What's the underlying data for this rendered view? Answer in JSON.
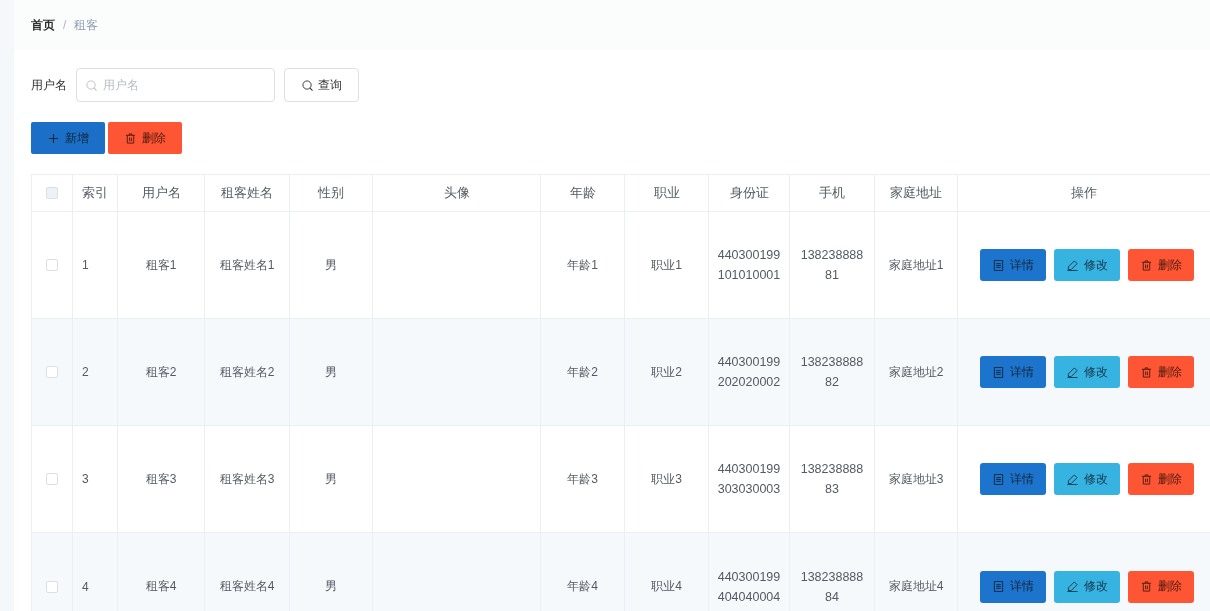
{
  "breadcrumb": {
    "separator": "/",
    "items": [
      {
        "label": "首页",
        "current": false
      },
      {
        "label": "租客",
        "current": true
      }
    ]
  },
  "search": {
    "label": "用户名",
    "placeholder": "用户名",
    "button": "查询"
  },
  "toolbar": [
    {
      "label": "新增",
      "kind": "add"
    },
    {
      "label": "删除",
      "kind": "delete"
    }
  ],
  "table": {
    "select_all": {
      "checked": false
    },
    "columns": [
      "索引",
      "用户名",
      "租客姓名",
      "性别",
      "头像",
      "年龄",
      "职业",
      "身份证",
      "手机",
      "家庭地址",
      "操作"
    ],
    "rows": [
      {
        "checked": false,
        "index": "1",
        "username": "租客1",
        "tenant_name": "租客姓名1",
        "gender": "男",
        "age": "年龄1",
        "occupation": "职业1",
        "id_card": "440300199101010001",
        "phone": "13823888881",
        "address": "家庭地址1",
        "actions": [
          {
            "label": "详情",
            "kind": "detail"
          },
          {
            "label": "修改",
            "kind": "edit"
          },
          {
            "label": "删除",
            "kind": "delete"
          }
        ]
      },
      {
        "checked": false,
        "index": "2",
        "username": "租客2",
        "tenant_name": "租客姓名2",
        "gender": "男",
        "age": "年龄2",
        "occupation": "职业2",
        "id_card": "440300199202020002",
        "phone": "13823888882",
        "address": "家庭地址2",
        "actions": [
          {
            "label": "详情",
            "kind": "detail"
          },
          {
            "label": "修改",
            "kind": "edit"
          },
          {
            "label": "删除",
            "kind": "delete"
          }
        ]
      },
      {
        "checked": false,
        "index": "3",
        "username": "租客3",
        "tenant_name": "租客姓名3",
        "gender": "男",
        "age": "年龄3",
        "occupation": "职业3",
        "id_card": "440300199303030003",
        "phone": "13823888883",
        "address": "家庭地址3",
        "actions": [
          {
            "label": "详情",
            "kind": "detail"
          },
          {
            "label": "修改",
            "kind": "edit"
          },
          {
            "label": "删除",
            "kind": "delete"
          }
        ]
      },
      {
        "checked": false,
        "index": "4",
        "username": "租客4",
        "tenant_name": "租客姓名4",
        "gender": "男",
        "age": "年龄4",
        "occupation": "职业4",
        "id_card": "440300199404040004",
        "phone": "13823888884",
        "address": "家庭地址4",
        "actions": [
          {
            "label": "详情",
            "kind": "detail"
          },
          {
            "label": "修改",
            "kind": "edit"
          },
          {
            "label": "删除",
            "kind": "delete"
          }
        ]
      }
    ]
  }
}
